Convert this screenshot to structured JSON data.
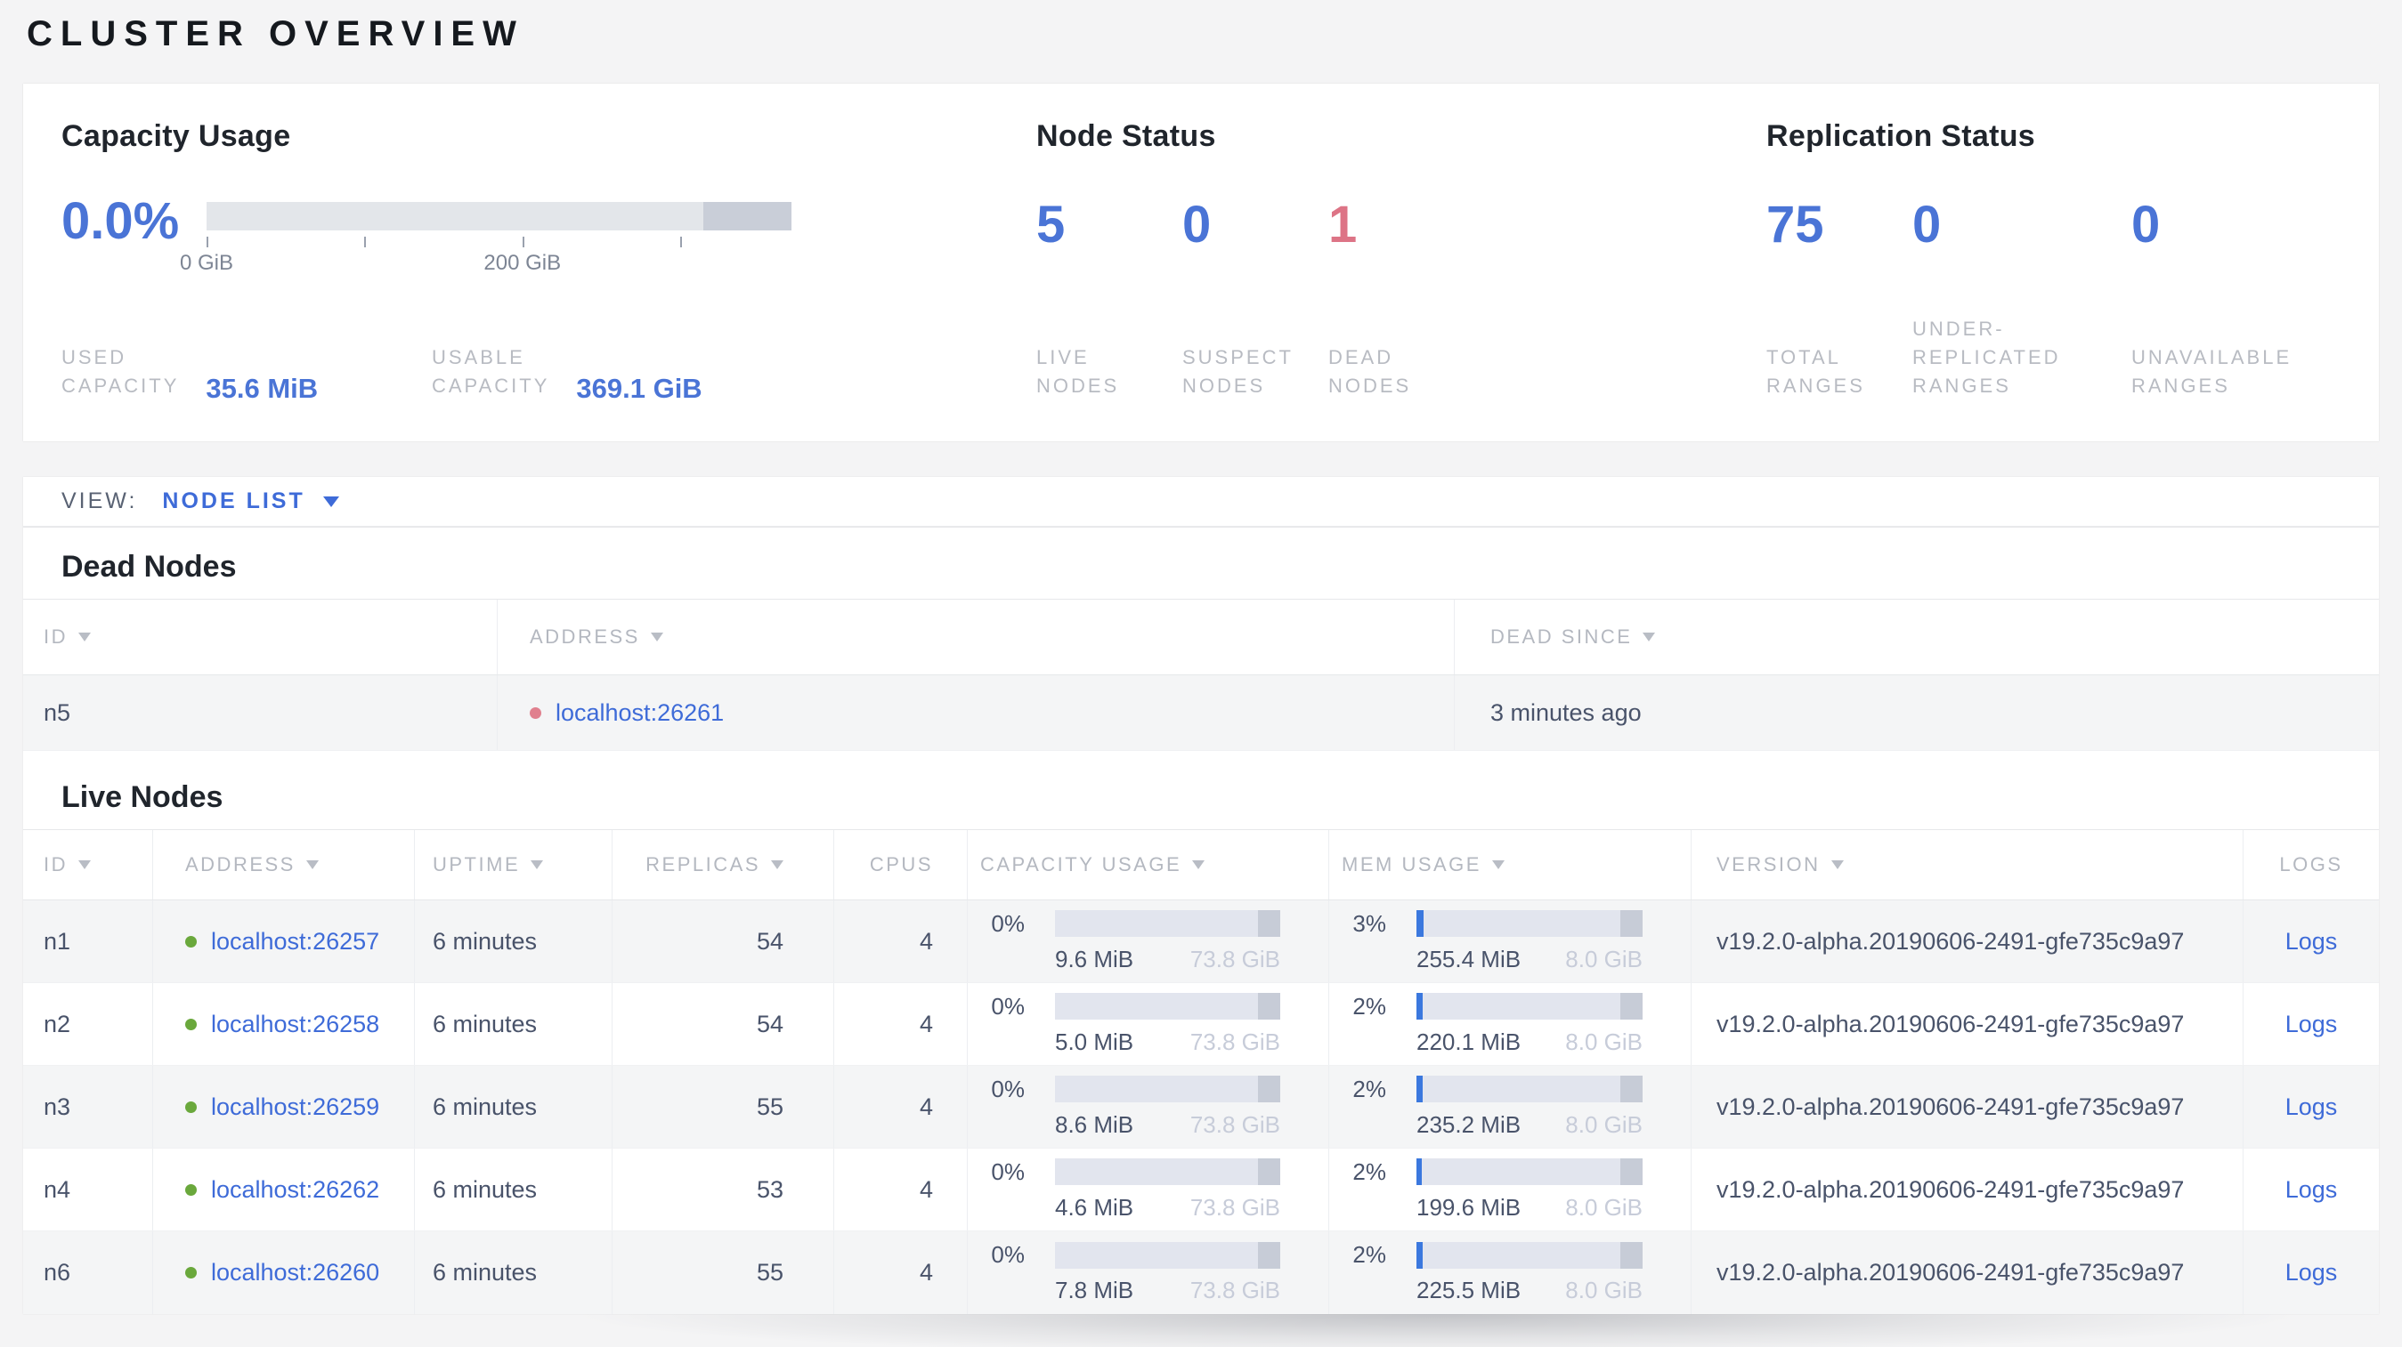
{
  "page": {
    "title": "CLUSTER OVERVIEW"
  },
  "colors": {
    "accent_blue": "#4a74d6",
    "link_blue": "#3e6bd8",
    "dead_red": "#dd7486",
    "live_green": "#6aa83c",
    "bar_background": "#e2e5ee",
    "bar_end_segment": "#c7ccd7"
  },
  "summary": {
    "capacity": {
      "title": "Capacity Usage",
      "percent": "0.0%",
      "bar": {
        "dark_segment_percent": 15
      },
      "ticks": [
        {
          "label": "0 GiB",
          "pos": 0
        },
        {
          "label": "",
          "pos": 27
        },
        {
          "label": "200 GiB",
          "pos": 54
        },
        {
          "label": "",
          "pos": 81
        }
      ],
      "used": {
        "lines": [
          "USED",
          "CAPACITY"
        ],
        "value": "35.6 MiB"
      },
      "usable": {
        "lines": [
          "USABLE",
          "CAPACITY"
        ],
        "value": "369.1 GiB"
      }
    },
    "node_status": {
      "title": "Node Status",
      "stats": [
        {
          "value": "5",
          "lines": [
            "LIVE",
            "NODES"
          ],
          "state": "live"
        },
        {
          "value": "0",
          "lines": [
            "SUSPECT",
            "NODES"
          ],
          "state": "suspect"
        },
        {
          "value": "1",
          "lines": [
            "DEAD",
            "NODES"
          ],
          "state": "dead"
        }
      ]
    },
    "replication_status": {
      "title": "Replication Status",
      "stats": [
        {
          "value": "75",
          "lines": [
            "TOTAL",
            "RANGES",
            ""
          ]
        },
        {
          "value": "0",
          "lines": [
            "UNDER-",
            "REPLICATED",
            "RANGES"
          ]
        },
        {
          "value": "0",
          "lines": [
            "UNAVAILABLE",
            "RANGES",
            ""
          ]
        }
      ]
    }
  },
  "view_bar": {
    "label": "VIEW:",
    "selected": "NODE LIST"
  },
  "dead_nodes": {
    "title": "Dead Nodes",
    "columns": [
      {
        "label": "ID"
      },
      {
        "label": "ADDRESS"
      },
      {
        "label": "DEAD SINCE"
      }
    ],
    "rows": [
      {
        "id": "n5",
        "address": "localhost:26261",
        "dead_since": "3 minutes ago"
      }
    ]
  },
  "live_nodes": {
    "title": "Live Nodes",
    "columns": [
      {
        "label": "ID"
      },
      {
        "label": "ADDRESS"
      },
      {
        "label": "UPTIME"
      },
      {
        "label": "REPLICAS"
      },
      {
        "label": "CPUS"
      },
      {
        "label": "CAPACITY USAGE"
      },
      {
        "label": "MEM USAGE"
      },
      {
        "label": "VERSION"
      },
      {
        "label": "LOGS"
      }
    ],
    "logs_label": "Logs",
    "rows": [
      {
        "id": "n1",
        "address": "localhost:26257",
        "uptime": "6 minutes",
        "replicas": "54",
        "cpus": "4",
        "capacity": {
          "percent": "0%",
          "fill": 0,
          "used": "9.6 MiB",
          "total": "73.8 GiB"
        },
        "memory": {
          "percent": "3%",
          "fill": 3,
          "used": "255.4 MiB",
          "total": "8.0 GiB"
        },
        "version": "v19.2.0-alpha.20190606-2491-gfe735c9a97"
      },
      {
        "id": "n2",
        "address": "localhost:26258",
        "uptime": "6 minutes",
        "replicas": "54",
        "cpus": "4",
        "capacity": {
          "percent": "0%",
          "fill": 0,
          "used": "5.0 MiB",
          "total": "73.8 GiB"
        },
        "memory": {
          "percent": "2%",
          "fill": 2.7,
          "used": "220.1 MiB",
          "total": "8.0 GiB"
        },
        "version": "v19.2.0-alpha.20190606-2491-gfe735c9a97"
      },
      {
        "id": "n3",
        "address": "localhost:26259",
        "uptime": "6 minutes",
        "replicas": "55",
        "cpus": "4",
        "capacity": {
          "percent": "0%",
          "fill": 0,
          "used": "8.6 MiB",
          "total": "73.8 GiB"
        },
        "memory": {
          "percent": "2%",
          "fill": 2.9,
          "used": "235.2 MiB",
          "total": "8.0 GiB"
        },
        "version": "v19.2.0-alpha.20190606-2491-gfe735c9a97"
      },
      {
        "id": "n4",
        "address": "localhost:26262",
        "uptime": "6 minutes",
        "replicas": "53",
        "cpus": "4",
        "capacity": {
          "percent": "0%",
          "fill": 0,
          "used": "4.6 MiB",
          "total": "73.8 GiB"
        },
        "memory": {
          "percent": "2%",
          "fill": 2.4,
          "used": "199.6 MiB",
          "total": "8.0 GiB"
        },
        "version": "v19.2.0-alpha.20190606-2491-gfe735c9a97"
      },
      {
        "id": "n6",
        "address": "localhost:26260",
        "uptime": "6 minutes",
        "replicas": "55",
        "cpus": "4",
        "capacity": {
          "percent": "0%",
          "fill": 0,
          "used": "7.8 MiB",
          "total": "73.8 GiB"
        },
        "memory": {
          "percent": "2%",
          "fill": 2.8,
          "used": "225.5 MiB",
          "total": "8.0 GiB"
        },
        "version": "v19.2.0-alpha.20190606-2491-gfe735c9a97"
      }
    ]
  }
}
